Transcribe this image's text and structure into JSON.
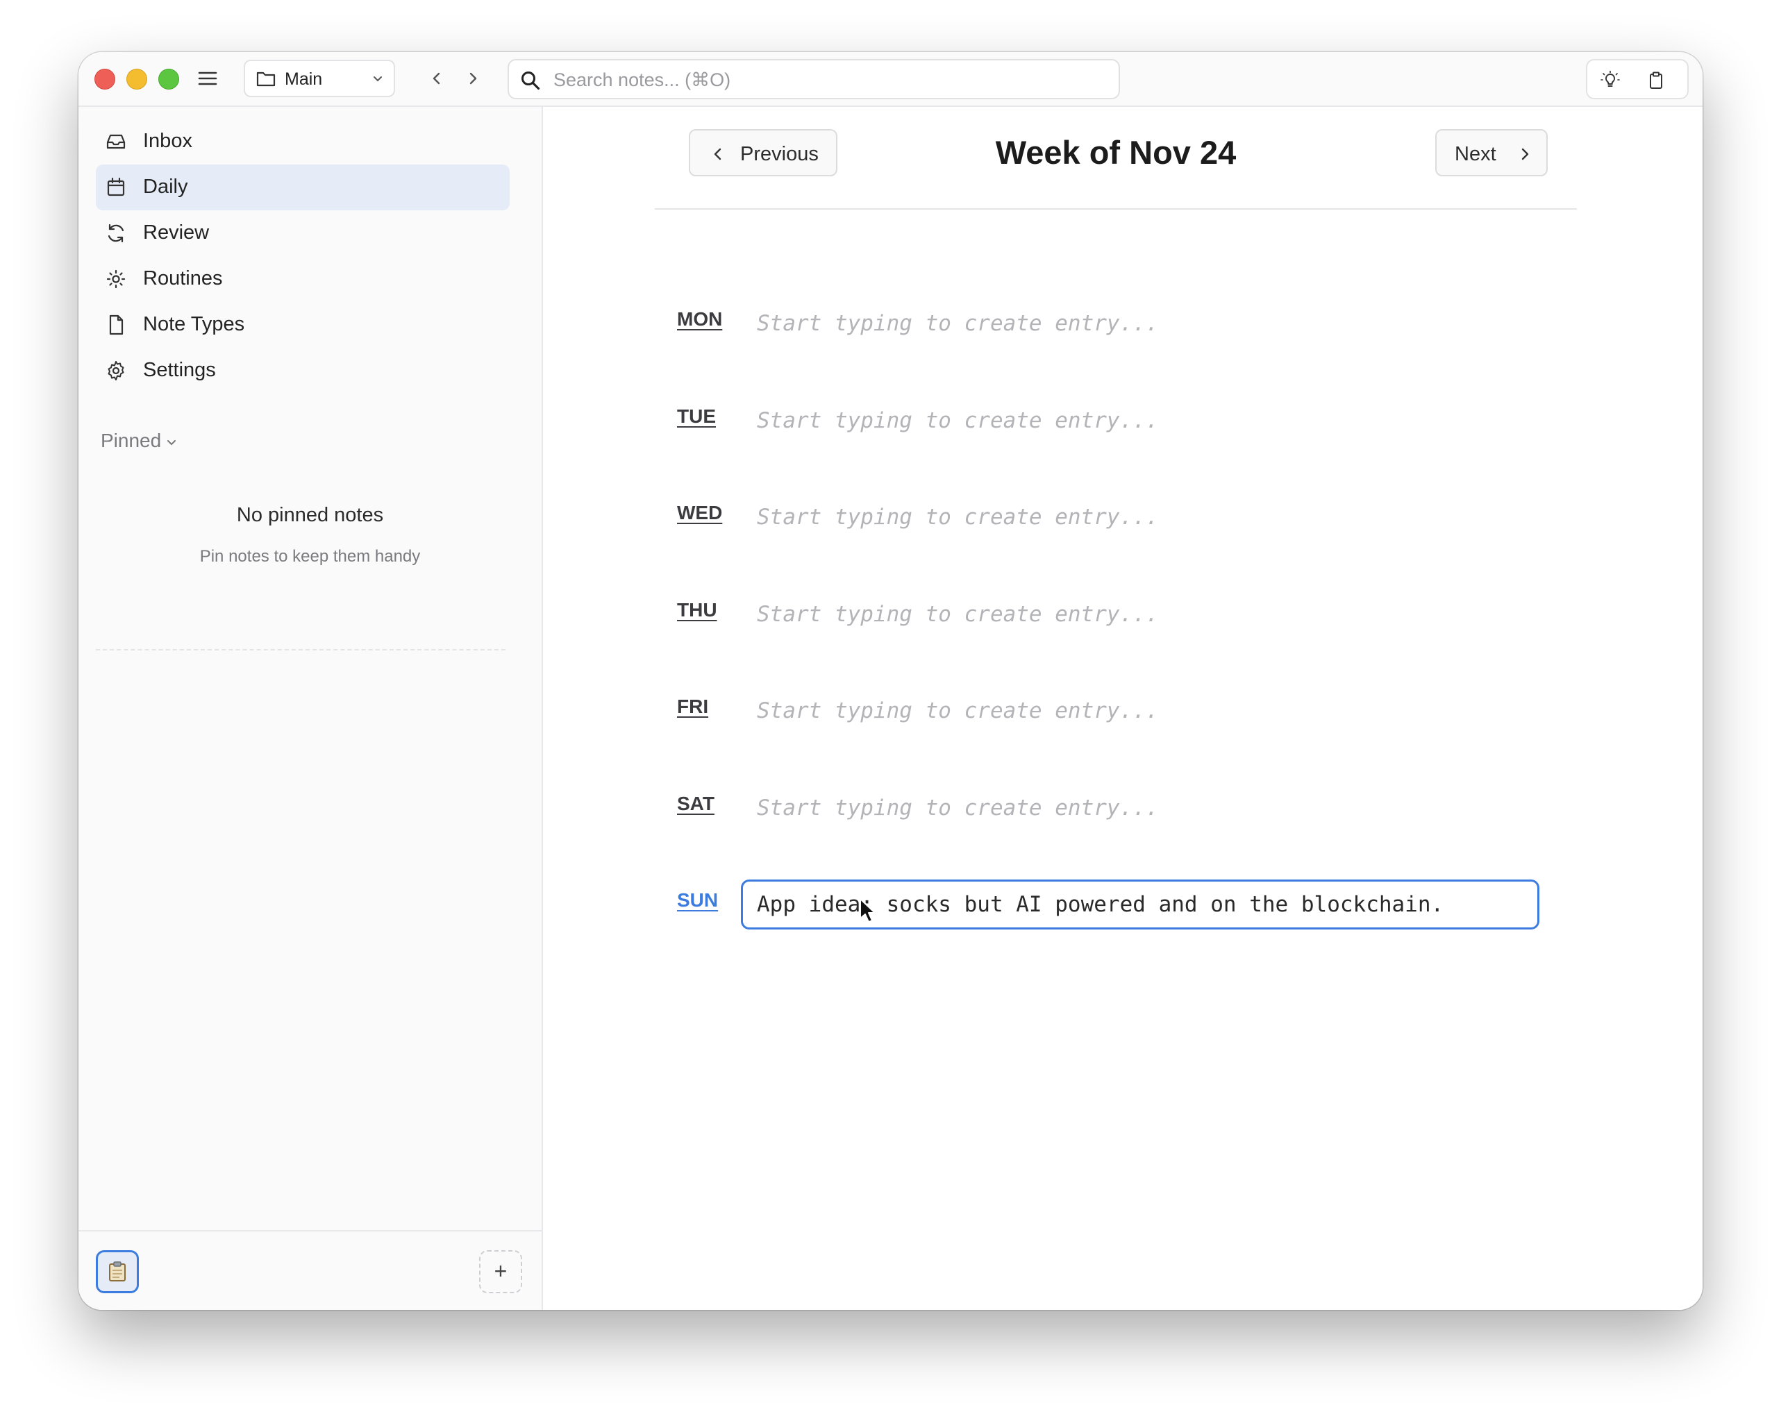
{
  "titlebar": {
    "vault_name": "Main",
    "search_placeholder": "Search notes... (⌘O)"
  },
  "sidebar": {
    "items": [
      {
        "label": "Inbox",
        "icon": "inbox-icon"
      },
      {
        "label": "Daily",
        "icon": "calendar-icon",
        "active": true
      },
      {
        "label": "Review",
        "icon": "refresh-icon"
      },
      {
        "label": "Routines",
        "icon": "sun-icon"
      },
      {
        "label": "Note Types",
        "icon": "document-icon"
      },
      {
        "label": "Settings",
        "icon": "gear-icon"
      }
    ],
    "pinned_label": "Pinned",
    "empty_title": "No pinned notes",
    "empty_subtitle": "Pin notes to keep them handy",
    "add_label": "+"
  },
  "main": {
    "week_title": "Week of Nov 24",
    "prev_label": "Previous",
    "next_label": "Next",
    "entry_placeholder": "Start typing to create entry...",
    "days": [
      {
        "label": "MON",
        "value": ""
      },
      {
        "label": "TUE",
        "value": ""
      },
      {
        "label": "WED",
        "value": ""
      },
      {
        "label": "THU",
        "value": ""
      },
      {
        "label": "FRI",
        "value": ""
      },
      {
        "label": "SAT",
        "value": ""
      },
      {
        "label": "SUN",
        "value": "App idea: socks but AI powered and on the blockchain.",
        "active": true
      }
    ]
  },
  "colors": {
    "accent": "#3c7cdf",
    "active_nav_bg": "#e6ecf7",
    "traffic_red": "#ee5f57",
    "traffic_yellow": "#f4bd2f",
    "traffic_green": "#5dc641"
  }
}
